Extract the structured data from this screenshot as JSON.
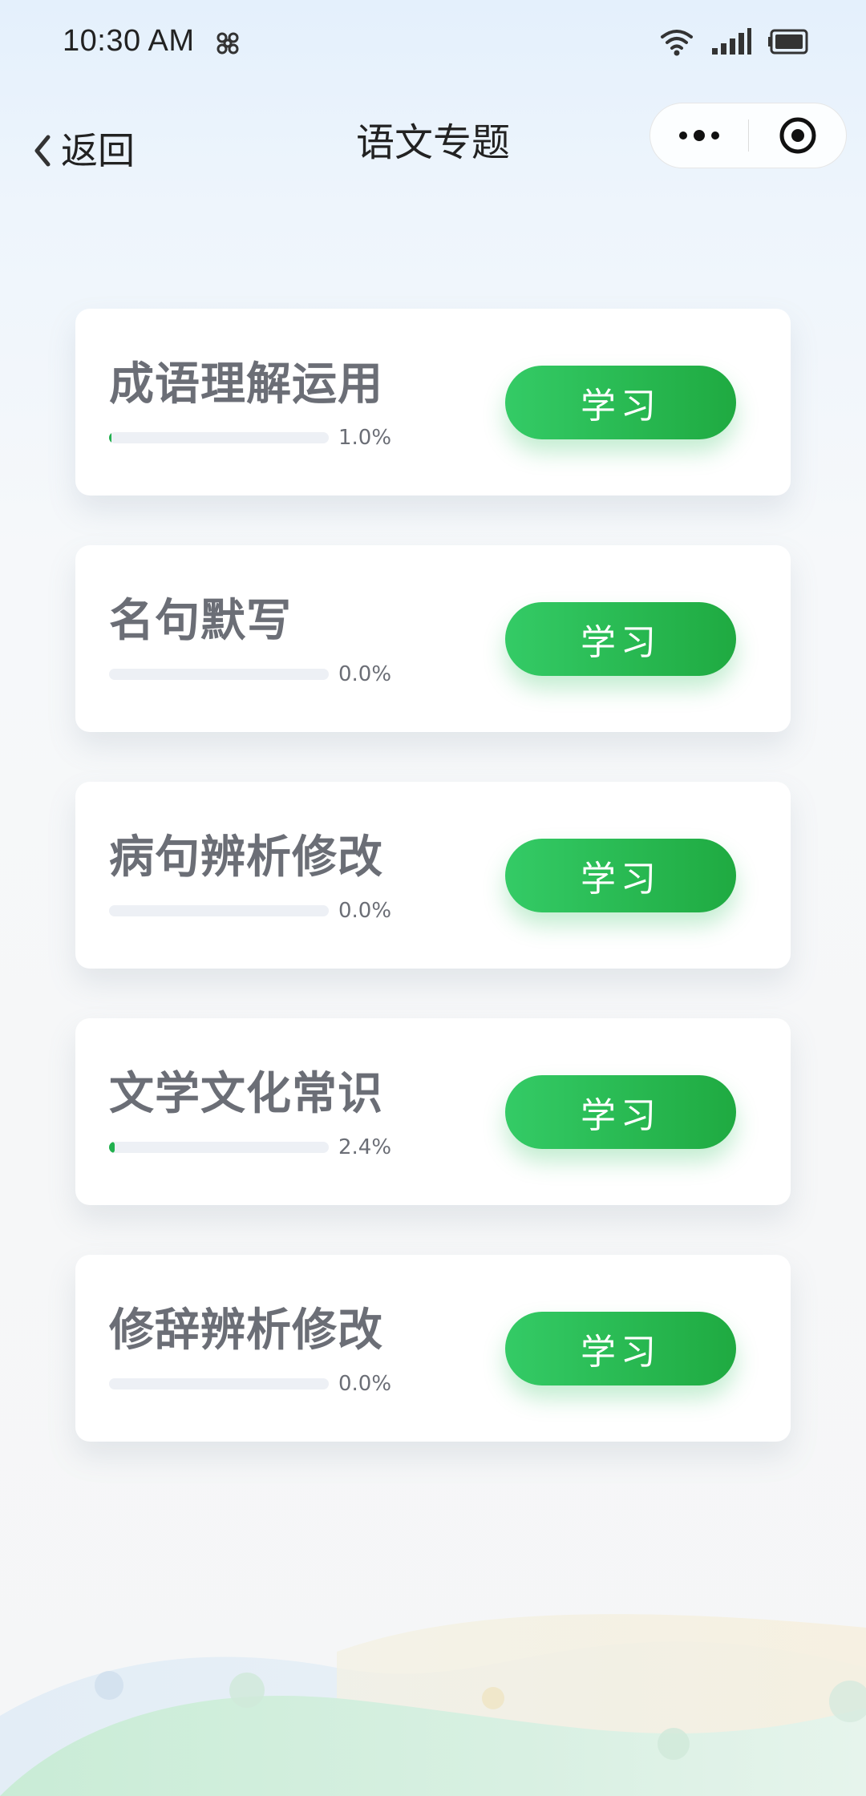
{
  "status_bar": {
    "time": "10:30 AM",
    "icons": [
      "knot-icon",
      "wifi-icon",
      "signal-icon",
      "battery-icon"
    ]
  },
  "nav": {
    "back_label": "返回",
    "title": "语文专题",
    "icons": [
      "back-chevron-icon",
      "more-dots-icon",
      "close-target-icon"
    ]
  },
  "topics": [
    {
      "name": "成语理解运用",
      "progress": 0.01,
      "percent_text": "1.0%",
      "button_label": "学习"
    },
    {
      "name": "名句默写",
      "progress": 0.0,
      "percent_text": "0.0%",
      "button_label": "学习"
    },
    {
      "name": "病句辨析修改",
      "progress": 0.0,
      "percent_text": "0.0%",
      "button_label": "学习"
    },
    {
      "name": "文学文化常识",
      "progress": 0.024,
      "percent_text": "2.4%",
      "button_label": "学习"
    },
    {
      "name": "修辞辨析修改",
      "progress": 0.0,
      "percent_text": "0.0%",
      "button_label": "学习"
    }
  ],
  "colors": {
    "accent_green": "#22b04e",
    "button_gradient_start": "#34cb66",
    "button_gradient_end": "#1faa41",
    "topic_text": "#6b6e76",
    "progress_track": "#edf0f5"
  }
}
